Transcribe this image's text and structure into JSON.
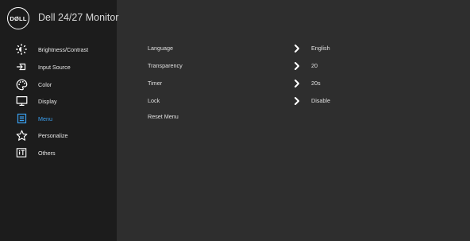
{
  "header": {
    "logo_text": "DØLL",
    "model_name": "Dell 24/27 Monitor"
  },
  "sidebar": {
    "items": [
      {
        "label": "Brightness/Contrast",
        "icon": "brightness-icon"
      },
      {
        "label": "Input Source",
        "icon": "input-source-icon"
      },
      {
        "label": "Color",
        "icon": "color-icon"
      },
      {
        "label": "Display",
        "icon": "display-icon"
      },
      {
        "label": "Menu",
        "icon": "menu-icon",
        "active": true
      },
      {
        "label": "Personalize",
        "icon": "star-icon"
      },
      {
        "label": "Others",
        "icon": "others-icon"
      }
    ]
  },
  "menu_settings": {
    "rows": [
      {
        "label": "Language",
        "value": "English"
      },
      {
        "label": "Transparency",
        "value": "20"
      },
      {
        "label": "Timer",
        "value": "20s"
      },
      {
        "label": "Lock",
        "value": "Disable"
      },
      {
        "label": "Reset Menu"
      }
    ]
  },
  "colors": {
    "accent": "#3aa0f0",
    "sidebar_bg": "#1c1c1c",
    "main_bg": "#2e2e2e"
  }
}
